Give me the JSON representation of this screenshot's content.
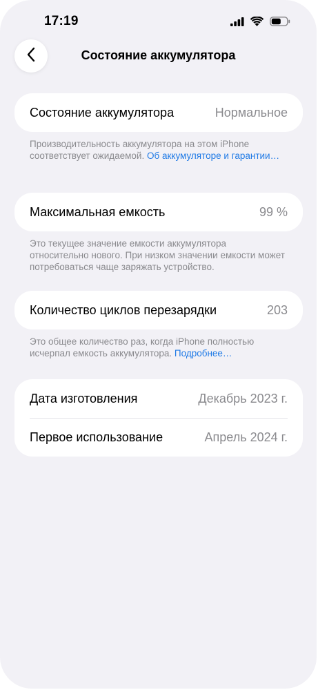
{
  "status_bar": {
    "time": "17:19",
    "icons": [
      "cellular-signal-icon",
      "wifi-icon",
      "battery-icon"
    ]
  },
  "nav": {
    "back_icon": "chevron-left-icon",
    "title": "Состояние аккумулятора"
  },
  "battery_health": {
    "label": "Состояние аккумулятора",
    "value": "Нормальное",
    "footnote_text": "Производительность аккумулятора на этом iPhone соответствует ожидаемой. ",
    "footnote_link": "Об аккумуляторе и гарантии…"
  },
  "max_capacity": {
    "label": "Максимальная емкость",
    "value": "99 %",
    "footnote_text": "Это текущее значение емкости аккумулятора относительно нового. При низком значении емкости может потребоваться чаще заряжать устройство."
  },
  "cycle_count": {
    "label": "Количество циклов перезарядки",
    "value": "203",
    "footnote_text": "Это общее количество раз, когда iPhone полностью исчерпал емкость аккумулятора. ",
    "footnote_link": "Подробнее…"
  },
  "dates": {
    "manufacture_label": "Дата изготовления",
    "manufacture_value": "Декабрь 2023 г.",
    "first_use_label": "Первое использование",
    "first_use_value": "Апрель 2024 г."
  },
  "colors": {
    "background": "#f2f1f6",
    "card": "#ffffff",
    "link": "#1f7ae6",
    "secondary_text": "#8a8a8e"
  }
}
